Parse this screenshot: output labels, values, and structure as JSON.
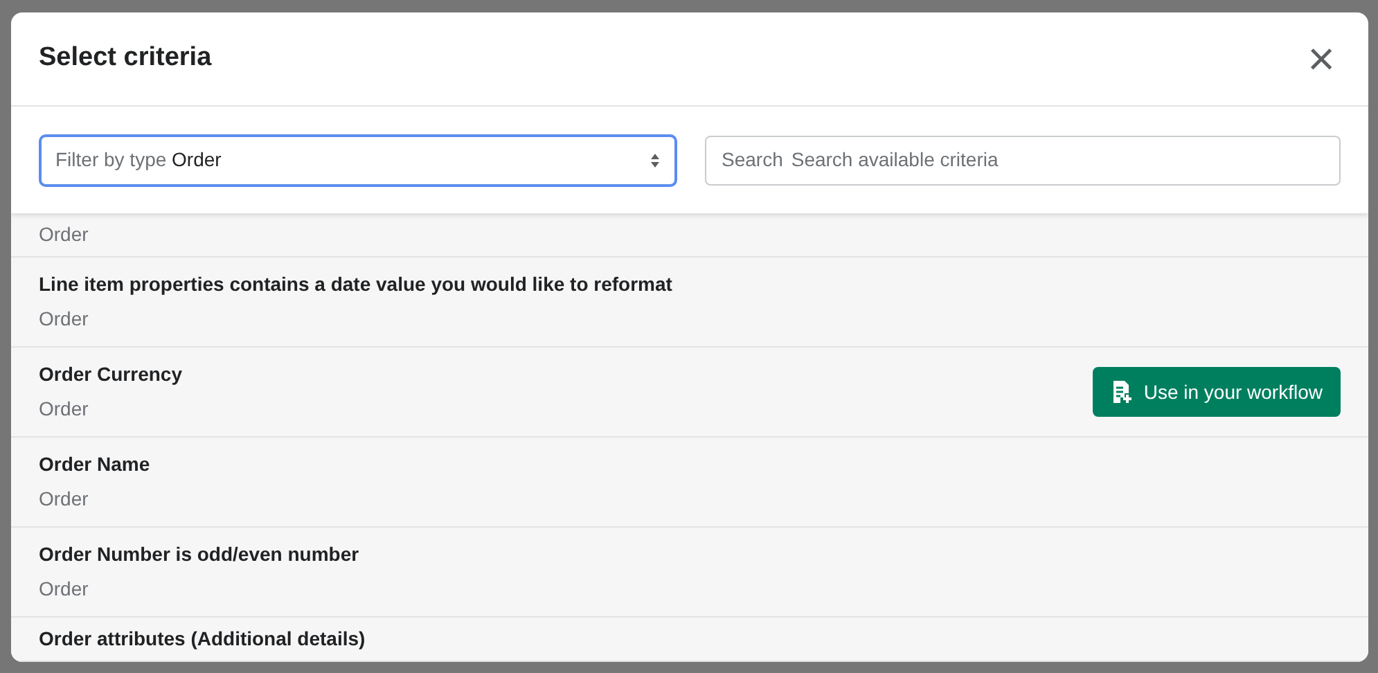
{
  "dialog": {
    "title": "Select criteria",
    "close": "×"
  },
  "filter": {
    "label": "Filter by type",
    "value": "Order"
  },
  "search": {
    "label": "Search",
    "placeholder": "Search available criteria"
  },
  "criteria": [
    {
      "subtitle": "Order"
    },
    {
      "title": "Line item properties contains a date value you would like to reformat",
      "subtitle": "Order"
    },
    {
      "title": "Order Currency",
      "subtitle": "Order",
      "action": "Use in your workflow"
    },
    {
      "title": "Order Name",
      "subtitle": "Order"
    },
    {
      "title": "Order Number is odd/even number",
      "subtitle": "Order"
    },
    {
      "title": "Order attributes (Additional details)"
    }
  ]
}
